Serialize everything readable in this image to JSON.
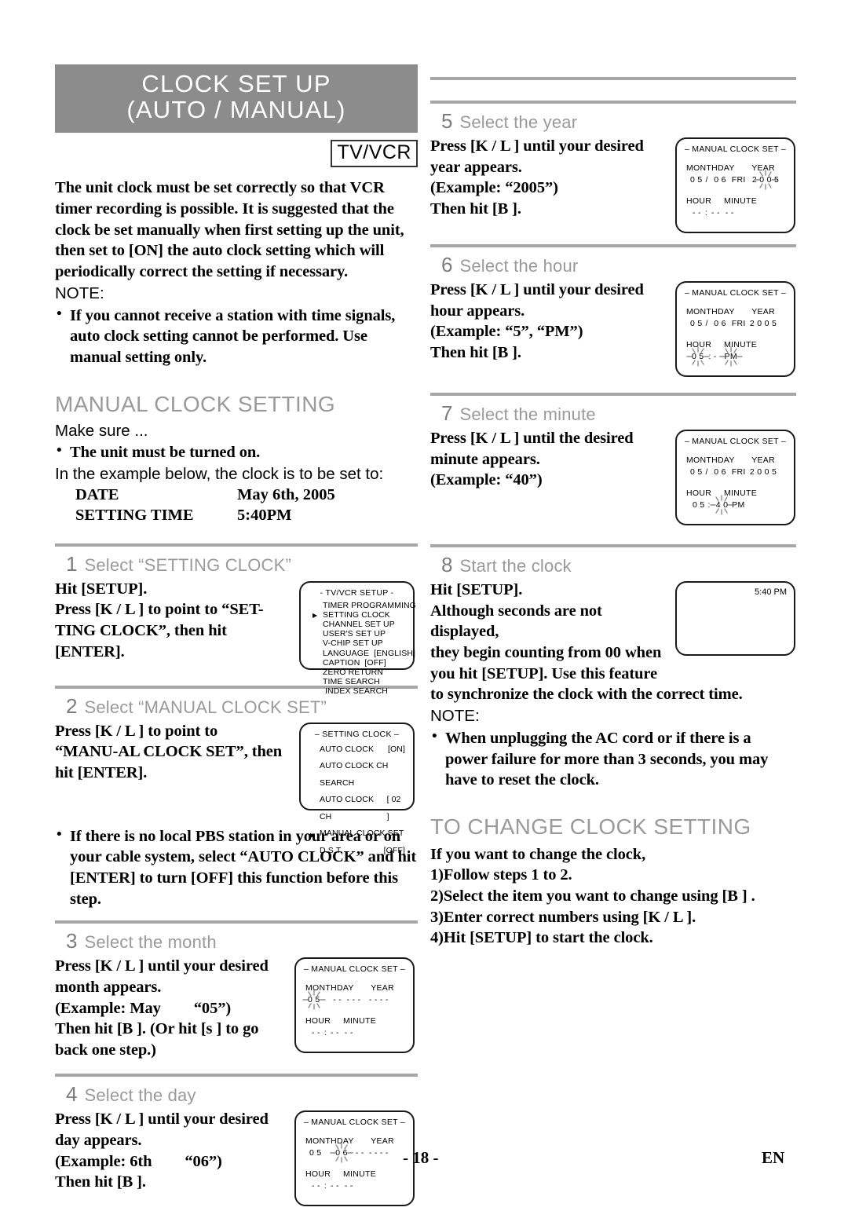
{
  "header": {
    "title_line1": "CLOCK SET UP",
    "title_line2": "(AUTO / MANUAL)",
    "badge": "TV/VCR"
  },
  "intro": {
    "paragraph": "The unit clock must be set correctly so that VCR timer recording is possible. It is suggested that the clock be set manually when first setting up the unit, then set to [ON] the auto clock setting which will periodically correct the setting if necessary.",
    "note_label": "NOTE:",
    "note_bullet": "If you cannot receive a station with time signals, auto clock setting cannot be performed. Use manual setting only."
  },
  "manual_section": {
    "heading": "MANUAL CLOCK SETTING",
    "make_sure": "Make sure ...",
    "make_sure_bullet": "The unit must be turned on.",
    "example_lead": "In the example below, the clock is to be set to:",
    "rows": [
      {
        "key": "DATE",
        "value": "May 6th, 2005"
      },
      {
        "key": "SETTING TIME",
        "value": "5:40PM"
      }
    ]
  },
  "steps": {
    "s1": {
      "num": "1",
      "label": "Select “SETTING CLOCK”",
      "line1": "Hit [SETUP].",
      "line2": "Press [K / L ] to point to “SET-TING CLOCK”, then hit [ENTER]."
    },
    "s2": {
      "num": "2",
      "label": "Select “MANUAL CLOCK SET”",
      "line1": "Press [K / L ] to point to “MANU-AL CLOCK SET”, then hit [ENTER]."
    },
    "pbs_bullet": "If there is no local PBS station in your area or on your cable system, select “AUTO CLOCK” and hit [ENTER] to turn [OFF] this function before this step.",
    "s3": {
      "num": "3",
      "label": "Select the month",
      "line1": "Press [K / L ] until your desired month appears.",
      "line2": "(Example: May",
      "line2b": "“05”)",
      "line3": "Then hit [B ]. (Or hit [s ] to go back one step.)"
    },
    "s4": {
      "num": "4",
      "label": "Select the day",
      "line1": "Press [K / L ] until your desired day appears.",
      "line2": "(Example: 6th",
      "line2b": "“06”)",
      "line3": "Then hit [B ]."
    },
    "s5": {
      "num": "5",
      "label": "Select the year",
      "line1": "Press [K / L ] until your desired year appears.",
      "line2": "(Example: “2005”)",
      "line3": "Then hit [B ]."
    },
    "s6": {
      "num": "6",
      "label": "Select the hour",
      "line1": "Press [K / L ] until your desired hour appears.",
      "line2": "(Example: “5”, “PM”)",
      "line3": "Then hit [B ]."
    },
    "s7": {
      "num": "7",
      "label": "Select the minute",
      "line1": "Press [K / L ] until the desired minute appears.",
      "line2": "(Example: “40”)"
    },
    "s8": {
      "num": "8",
      "label": "Start the clock",
      "line1": "Hit [SETUP].",
      "line2": "Although seconds are not displayed, they begin counting from 00 when you hit [SETUP]. Use this feature to synchronize the clock with the correct time.",
      "note_label": "NOTE:",
      "note_bullet": "When unplugging the AC cord or if there is a power failure for more than 3 seconds, you may have to reset the clock."
    }
  },
  "change_section": {
    "heading": "TO CHANGE CLOCK SETTING",
    "lead": "If you want to change the clock,",
    "items": [
      "1)Follow steps 1 to 2.",
      "2)Select the item you want to change using [B ] .",
      "3)Enter correct numbers using [K / L ].",
      "4)Hit [SETUP] to start the clock."
    ]
  },
  "osd": {
    "tvvcr_setup": {
      "title": "- TV/VCR SETUP -",
      "cursor_index": 1,
      "items": [
        "TIMER PROGRAMMING",
        "SETTING CLOCK",
        "CHANNEL SET UP",
        "USER'S SET UP",
        "V-CHIP SET UP",
        "LANGUAGE  [ENGLISH]",
        "CAPTION  [OFF]",
        "ZERO RETURN",
        "TIME SEARCH",
        " INDEX SEARCH"
      ]
    },
    "setting_clock": {
      "title": "– SETTING CLOCK –",
      "cursor_index": 3,
      "rows": [
        {
          "label": "AUTO CLOCK",
          "value": "[ON]"
        },
        {
          "label": "AUTO CLOCK CH SEARCH",
          "value": ""
        },
        {
          "label": "AUTO CLOCK CH",
          "value": "[ 02 ]"
        },
        {
          "label": "MANUAL CLOCK SET",
          "value": ""
        },
        {
          "label": "D.S.T.",
          "value": "[OFF]"
        }
      ]
    },
    "manual_clock_set": {
      "title": "– MANUAL CLOCK SET –",
      "col_month": "MONTH",
      "col_day": "DAY",
      "col_year": "YEAR",
      "col_hour": "HOUR",
      "col_minute": "MINUTE"
    },
    "step3_values": {
      "month": "0 5",
      "sep1": "/",
      "day": "- -",
      "weekday": "- - -",
      "year": "- - - -",
      "hour": "- -",
      "sep2": ":",
      "minute": "- -",
      "ampm": "- -"
    },
    "step4_values": {
      "month": "0 5",
      "sep1": "",
      "day": "0 6",
      "weekday": "- - -",
      "year": "- - - -",
      "hour": "- -",
      "sep2": ":",
      "minute": "- -",
      "ampm": "- -"
    },
    "step5_values": {
      "month": "0 5",
      "sep1": "/",
      "day": "0 6",
      "weekday": "FRI",
      "year": "2 0 0 5",
      "hour": "- -",
      "sep2": ":",
      "minute": "- -",
      "ampm": "- -"
    },
    "step6_values": {
      "month": "0 5",
      "sep1": "/",
      "day": "0 6",
      "weekday": "FRI",
      "year": "2 0 0 5",
      "hour": "0 5",
      "sep2": ":",
      "minute": "- -",
      "ampm": "PM"
    },
    "step7_values": {
      "month": "0 5",
      "sep1": "/",
      "day": "0 6",
      "weekday": "FRI",
      "year": "2 0 0 5",
      "hour": "0 5",
      "sep2": ":",
      "minute": "4 0",
      "ampm": "PM"
    },
    "clock_display": {
      "time": "5:40 PM"
    }
  },
  "footer": {
    "page": "- 18 -",
    "lang": "EN"
  }
}
